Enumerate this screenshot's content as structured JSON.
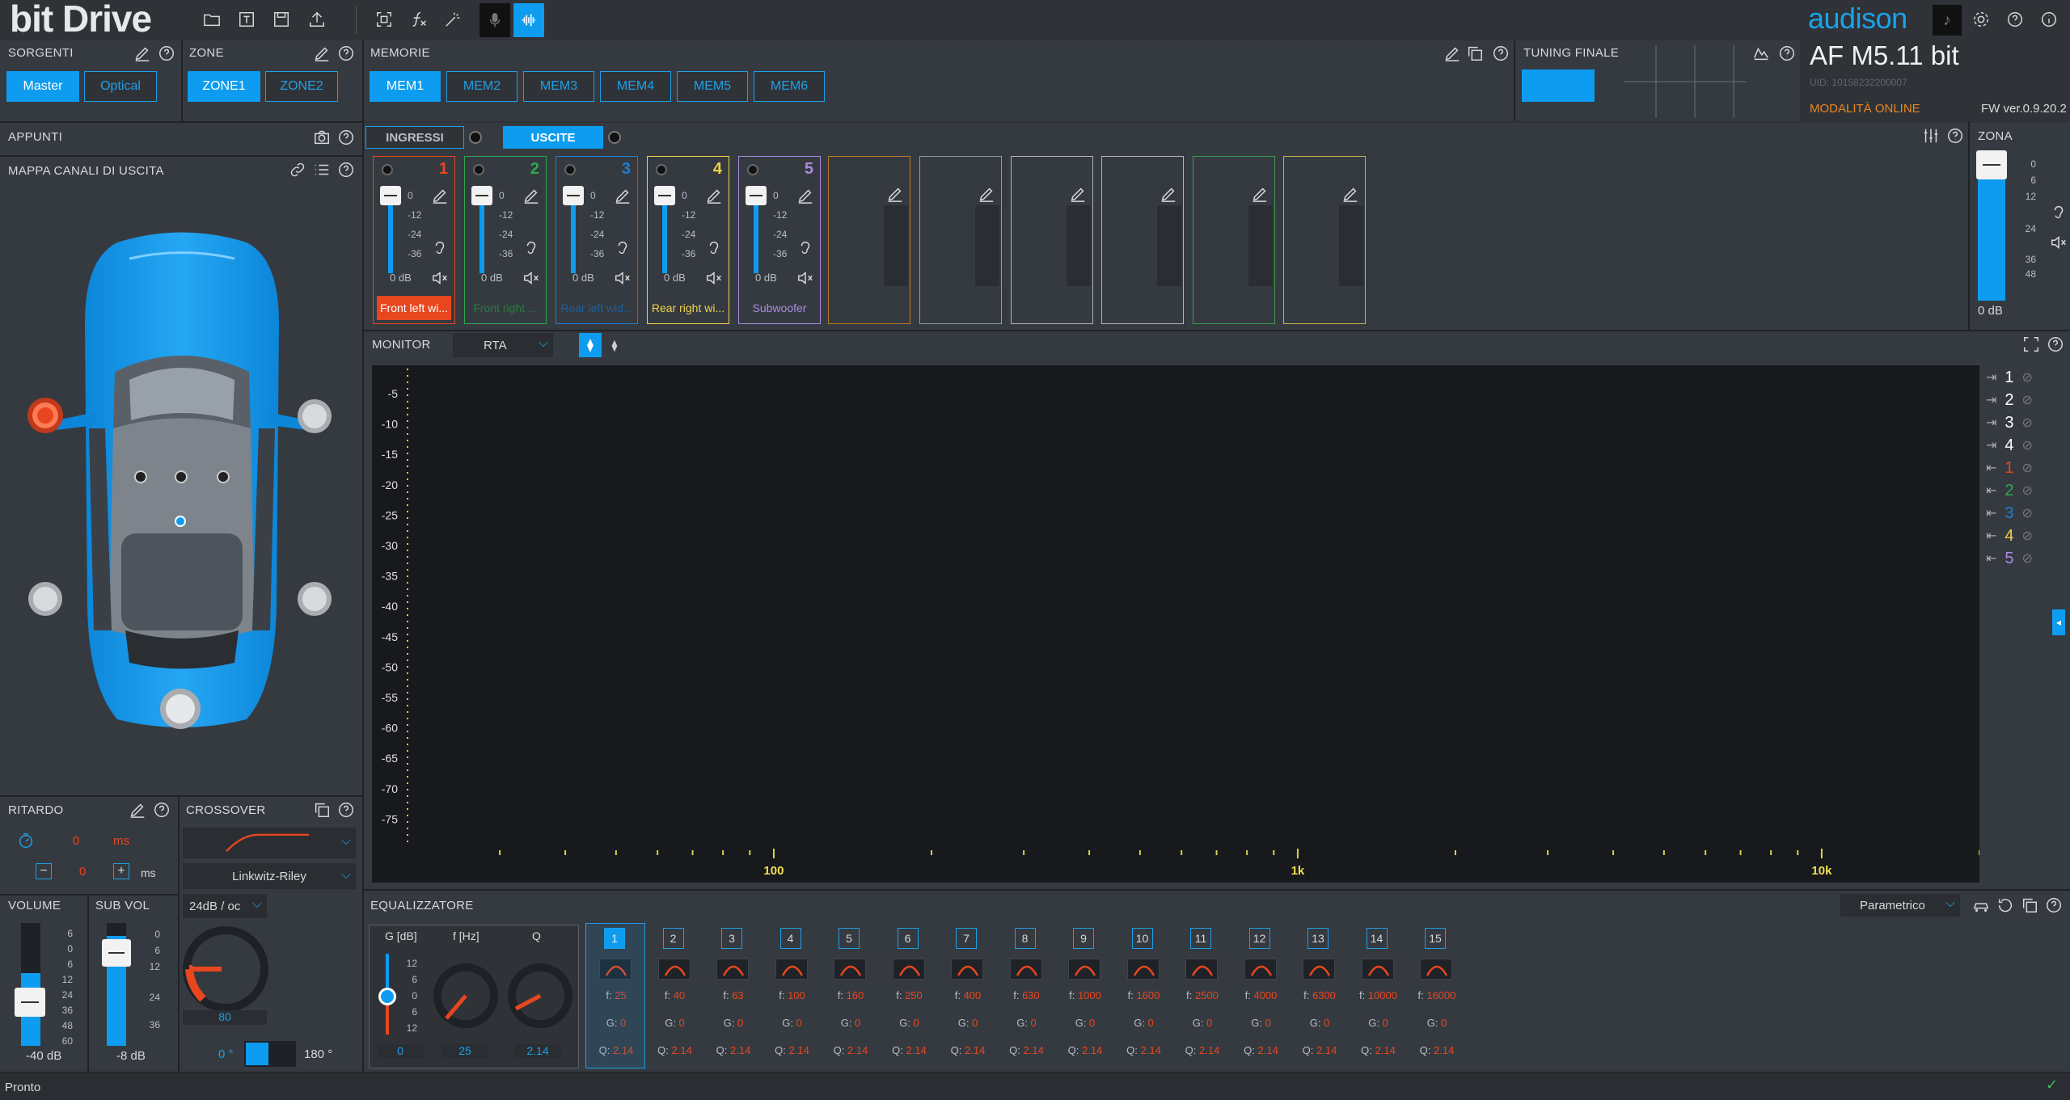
{
  "app": {
    "title": "bit Drive",
    "brand": "audison",
    "device": "AF M5.11 bit",
    "uid": "UID: 10158232200007",
    "mode": "MODALITÀ ONLINE",
    "fw": "FW ver.0.9.20.2",
    "status": "Pronto"
  },
  "colors": {
    "accent": "#0d9cf0",
    "ch1": "#e8461f",
    "ch2": "#2fa84f",
    "ch3": "#1e7fd0",
    "ch4": "#f0d24a",
    "ch5": "#a98be0",
    "orange": "#e8861f"
  },
  "sorgenti": {
    "title": "SORGENTI",
    "buttons": [
      "Master",
      "Optical"
    ]
  },
  "zone": {
    "title": "ZONE",
    "buttons": [
      "ZONE1",
      "ZONE2"
    ]
  },
  "memorie": {
    "title": "MEMORIE",
    "buttons": [
      "MEM1",
      "MEM2",
      "MEM3",
      "MEM4",
      "MEM5",
      "MEM6"
    ]
  },
  "tuning": {
    "title": "TUNING FINALE"
  },
  "appunti": {
    "title": "APPUNTI"
  },
  "mappa": {
    "title": "MAPPA CANALI DI USCITA"
  },
  "tabs": {
    "ingressi": "INGRESSI",
    "uscite": "USCITE"
  },
  "channels": [
    {
      "num": "1",
      "name": "Front left wi...",
      "db": "0 dB",
      "scale": [
        "0",
        "-12",
        "-24",
        "-36"
      ]
    },
    {
      "num": "2",
      "name": "Front right ...",
      "db": "0 dB",
      "scale": [
        "0",
        "-12",
        "-24",
        "-36"
      ]
    },
    {
      "num": "3",
      "name": "Rear left wid...",
      "db": "0 dB",
      "scale": [
        "0",
        "-12",
        "-24",
        "-36"
      ]
    },
    {
      "num": "4",
      "name": "Rear right wi...",
      "db": "0 dB",
      "scale": [
        "0",
        "-12",
        "-24",
        "-36"
      ]
    },
    {
      "num": "5",
      "name": "Subwoofer",
      "db": "0 dB",
      "scale": [
        "0",
        "-12",
        "-24",
        "-36"
      ]
    }
  ],
  "zona": {
    "title": "ZONA",
    "scale": [
      "0",
      "6",
      "12",
      "24",
      "36",
      "48"
    ],
    "db": "0 dB"
  },
  "monitor": {
    "title": "MONITOR",
    "mode": "RTA",
    "yticks": [
      "-5",
      "-10",
      "-15",
      "-20",
      "-25",
      "-30",
      "-35",
      "-40",
      "-45",
      "-50",
      "-55",
      "-60",
      "-65",
      "-70",
      "-75"
    ],
    "xticks": [
      "100",
      "1k",
      "10k"
    ]
  },
  "legend": {
    "inputs": [
      "1",
      "2",
      "3",
      "4"
    ],
    "outputs": [
      "1",
      "2",
      "3",
      "4",
      "5"
    ]
  },
  "ritardo": {
    "title": "RITARDO",
    "value": "0",
    "unit": "ms",
    "step": "0",
    "step_unit": "ms"
  },
  "crossover": {
    "title": "CROSSOVER",
    "type": "Linkwitz-Riley",
    "slope": "24dB / oc",
    "freq": "80",
    "phase0": "0 °",
    "phase180": "180 °"
  },
  "volume": {
    "title": "VOLUME",
    "scale": [
      "6",
      "0",
      "6",
      "12",
      "24",
      "36",
      "48",
      "60"
    ],
    "db": "-40 dB"
  },
  "subvol": {
    "title": "SUB VOL",
    "scale": [
      "0",
      "6",
      "12",
      "24",
      "36"
    ],
    "db": "-8 dB"
  },
  "eq": {
    "title": "EQUALIZZATORE",
    "mode": "Parametrico",
    "labels": {
      "g": "G [dB]",
      "f": "f [Hz]",
      "q": "Q"
    },
    "gscale": [
      "12",
      "6",
      "0",
      "6",
      "12"
    ],
    "values": {
      "g": "0",
      "f": "25",
      "q": "2.14"
    },
    "bands": [
      {
        "n": "1",
        "f": "25",
        "g": "0",
        "q": "2.14"
      },
      {
        "n": "2",
        "f": "40",
        "g": "0",
        "q": "2.14"
      },
      {
        "n": "3",
        "f": "63",
        "g": "0",
        "q": "2.14"
      },
      {
        "n": "4",
        "f": "100",
        "g": "0",
        "q": "2.14"
      },
      {
        "n": "5",
        "f": "160",
        "g": "0",
        "q": "2.14"
      },
      {
        "n": "6",
        "f": "250",
        "g": "0",
        "q": "2.14"
      },
      {
        "n": "7",
        "f": "400",
        "g": "0",
        "q": "2.14"
      },
      {
        "n": "8",
        "f": "630",
        "g": "0",
        "q": "2.14"
      },
      {
        "n": "9",
        "f": "1000",
        "g": "0",
        "q": "2.14"
      },
      {
        "n": "10",
        "f": "1600",
        "g": "0",
        "q": "2.14"
      },
      {
        "n": "11",
        "f": "2500",
        "g": "0",
        "q": "2.14"
      },
      {
        "n": "12",
        "f": "4000",
        "g": "0",
        "q": "2.14"
      },
      {
        "n": "13",
        "f": "6300",
        "g": "0",
        "q": "2.14"
      },
      {
        "n": "14",
        "f": "10000",
        "g": "0",
        "q": "2.14"
      },
      {
        "n": "15",
        "f": "16000",
        "g": "0",
        "q": "2.14"
      }
    ]
  }
}
